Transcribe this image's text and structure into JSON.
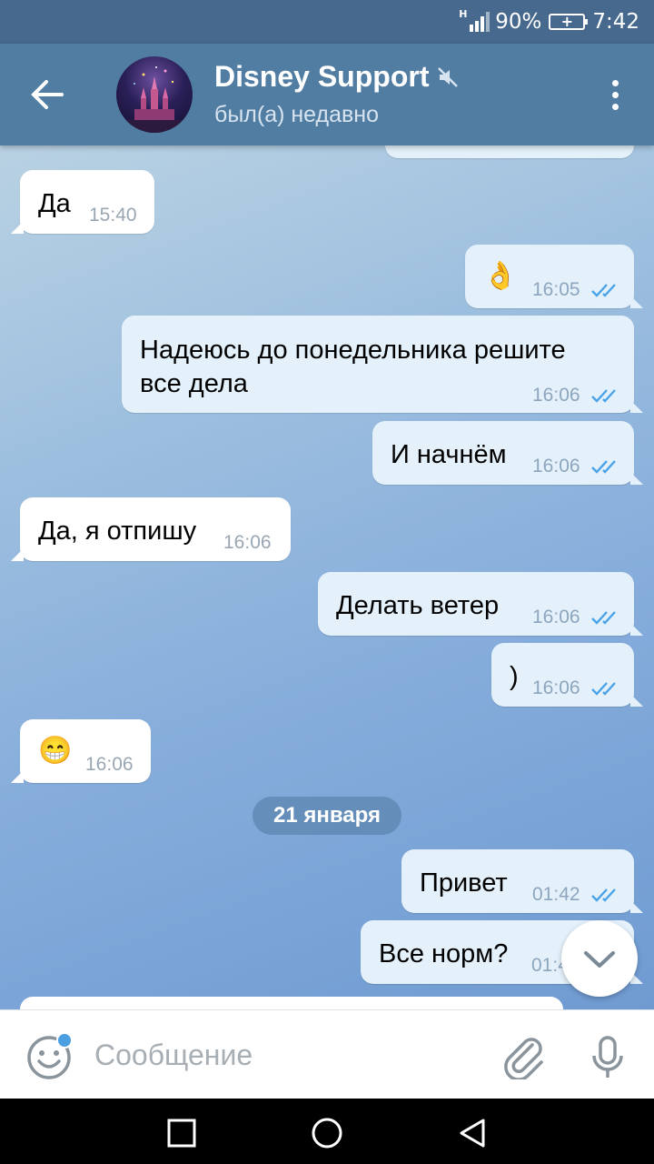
{
  "status_bar": {
    "network": "H",
    "battery_percent": "90%",
    "time": "7:42"
  },
  "header": {
    "back_icon": "arrow-left-icon",
    "title": "Disney Support",
    "muted_icon": "muted-speaker-icon",
    "subtitle": "был(а) недавно",
    "menu_icon": "more-vertical-icon"
  },
  "messages": [
    {
      "dir": "in",
      "text": "Да",
      "time": "15:40"
    },
    {
      "dir": "out",
      "text": "👌",
      "time": "16:05",
      "read": true
    },
    {
      "dir": "out",
      "text_line1": "Надеюсь до понедельника решите",
      "text_line2": "все дела",
      "time": "16:06",
      "read": true
    },
    {
      "dir": "out",
      "text": "И начнём",
      "time": "16:06",
      "read": true
    },
    {
      "dir": "in",
      "text": "Да, я отпишу",
      "time": "16:06"
    },
    {
      "dir": "out",
      "text": "Делать ветер",
      "time": "16:06",
      "read": true
    },
    {
      "dir": "out",
      "text": ")",
      "time": "16:06",
      "read": true
    },
    {
      "dir": "in",
      "text": "😁",
      "time": "16:06"
    },
    {
      "dir": "out",
      "text": "Привет",
      "time": "01:42",
      "read": true
    },
    {
      "dir": "out",
      "text": "Все норм?",
      "time": "01:4",
      "read": true
    }
  ],
  "date_separator": "21 января",
  "scroll_down_icon": "chevron-down-icon",
  "input": {
    "placeholder": "Сообщение",
    "emoji_icon": "smiley-icon",
    "attach_icon": "paperclip-icon",
    "mic_icon": "microphone-icon"
  },
  "colors": {
    "header": "#527da3",
    "status_bar": "#46698d",
    "outgoing_bubble": "#e4f1fb",
    "incoming_bubble": "#ffffff",
    "read_checks": "#4aa3e8"
  },
  "nav_bar": {
    "recents_icon": "square-icon",
    "home_icon": "circle-icon",
    "back_icon": "triangle-back-icon"
  }
}
